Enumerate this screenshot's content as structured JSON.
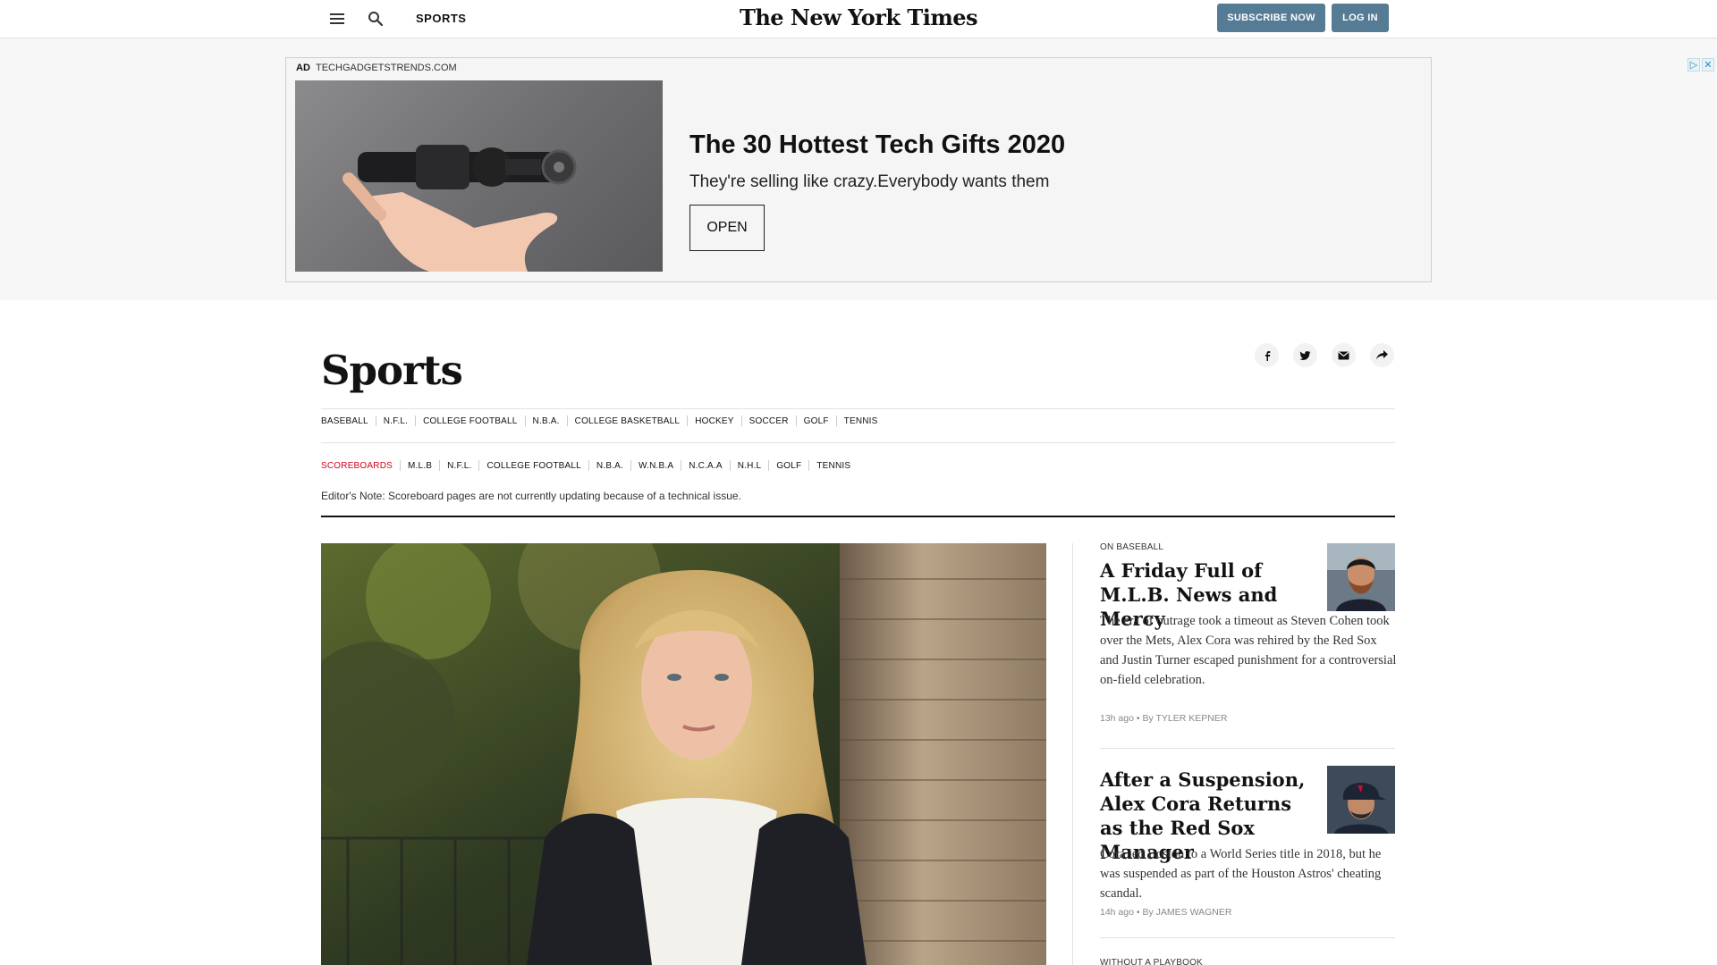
{
  "header": {
    "section": "SPORTS",
    "masthead": "The New York Times",
    "subscribe_label": "SUBSCRIBE NOW",
    "login_label": "LOG IN",
    "accent_color": "#567b95"
  },
  "ad": {
    "label": "AD",
    "domain": "TECHGADGETSTRENDS.COM",
    "title": "The 30 Hottest Tech Gifts 2020",
    "subtitle": "They're selling like crazy.Everybody wants them",
    "cta": "OPEN",
    "close_glyphs": [
      "▷",
      "✕"
    ]
  },
  "section": {
    "title": "Sports",
    "share_icons": [
      "facebook-icon",
      "twitter-icon",
      "email-icon",
      "share-icon"
    ],
    "primary_nav": [
      "BASEBALL",
      "N.F.L.",
      "COLLEGE FOOTBALL",
      "N.B.A.",
      "COLLEGE BASKETBALL",
      "HOCKEY",
      "SOCCER",
      "GOLF",
      "TENNIS"
    ],
    "scoreboard_nav": [
      "SCOREBOARDS",
      "M.L.B",
      "N.F.L.",
      "COLLEGE FOOTBALL",
      "N.B.A.",
      "W.N.B.A",
      "N.C.A.A",
      "N.H.L",
      "GOLF",
      "TENNIS"
    ],
    "scoreboard_accent": "#d0021b",
    "editor_note": "Editor's Note: Scoreboard pages are not currently updating because of a technical issue."
  },
  "stories": [
    {
      "kicker": "ON BASEBALL",
      "headline": "A Friday Full of M.L.B. News and Mercy",
      "summary": "The era of outrage took a timeout as Steven Cohen took over the Mets, Alex Cora was rehired by the Red Sox and Justin Turner escaped punishment for a controversial on-field celebration.",
      "time": "13h ago",
      "byline": "By TYLER KEPNER"
    },
    {
      "kicker": "",
      "headline": "After a Suspension, Alex Cora Returns as the Red Sox Manager",
      "summary": "Cora led Boston to a World Series title in 2018, but he was suspended as part of the Houston Astros' cheating scandal.",
      "time": "14h ago",
      "byline": "By JAMES WAGNER"
    },
    {
      "kicker": "WITHOUT A PLAYBOOK"
    }
  ]
}
